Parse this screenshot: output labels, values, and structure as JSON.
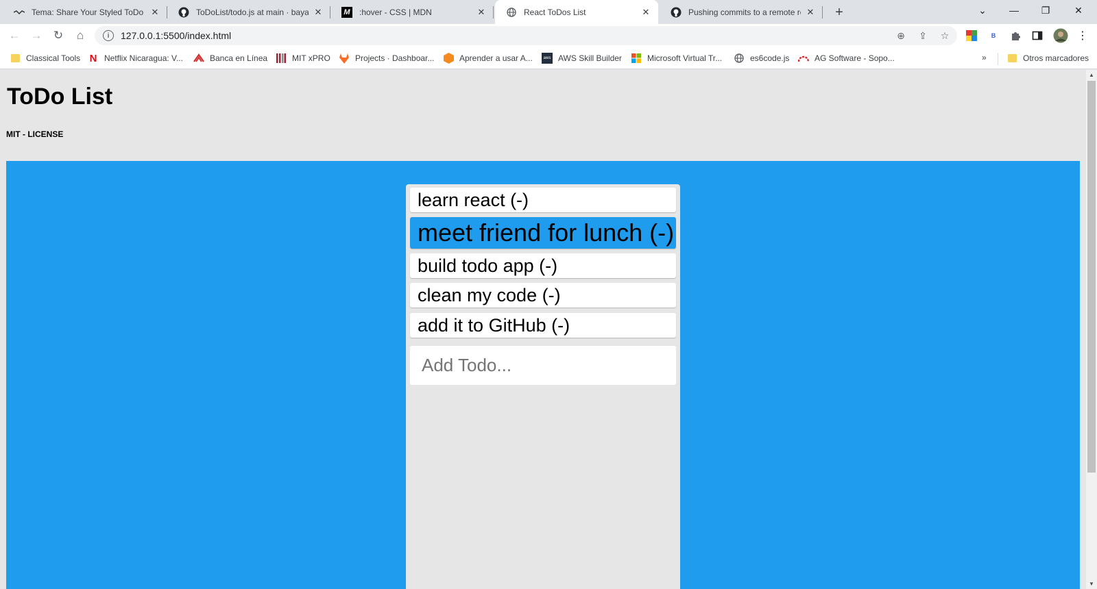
{
  "browser": {
    "tabs": [
      {
        "title": "Tema: Share Your Styled ToDo Lis",
        "favicon": "forum-icon"
      },
      {
        "title": "ToDoList/todo.js at main · bayard",
        "favicon": "github-icon"
      },
      {
        "title": ":hover - CSS | MDN",
        "favicon": "mdn-icon"
      },
      {
        "title": "React ToDos List",
        "favicon": "globe-icon"
      },
      {
        "title": "Pushing commits to a remote rep",
        "favicon": "github-icon"
      }
    ],
    "active_tab_index": 3,
    "address_bar": {
      "url": "127.0.0.1:5500/index.html"
    },
    "bookmarks": [
      {
        "label": "Classical Tools",
        "icon": "folder-icon"
      },
      {
        "label": "Netflix Nicaragua: V...",
        "icon": "netflix-icon"
      },
      {
        "label": "Banca en Línea",
        "icon": "bank-icon"
      },
      {
        "label": "MIT xPRO",
        "icon": "mit-icon"
      },
      {
        "label": "Projects · Dashboar...",
        "icon": "gitlab-icon"
      },
      {
        "label": "Aprender a usar A...",
        "icon": "cube-icon"
      },
      {
        "label": "AWS Skill Builder",
        "icon": "aws-icon"
      },
      {
        "label": "Microsoft Virtual Tr...",
        "icon": "microsoft-icon"
      },
      {
        "label": "es6code.js",
        "icon": "globe-icon"
      },
      {
        "label": "AG Software - Sopo...",
        "icon": "ag-icon"
      }
    ],
    "bookmarks_overflow": "»",
    "other_bookmarks": "Otros marcadores"
  },
  "app": {
    "title": "ToDo List",
    "license": "MIT - LICENSE",
    "todos": [
      {
        "text": "learn react (-)",
        "hovered": false
      },
      {
        "text": "meet friend for lunch (-)",
        "hovered": true
      },
      {
        "text": "build todo app (-)",
        "hovered": false
      },
      {
        "text": "clean my code (-)",
        "hovered": false
      },
      {
        "text": "add it to GitHub (-)",
        "hovered": false
      }
    ],
    "input": {
      "placeholder": "Add Todo...",
      "value": ""
    }
  },
  "colors": {
    "accent_blue": "#209cee",
    "page_background": "#e6e6e6"
  }
}
